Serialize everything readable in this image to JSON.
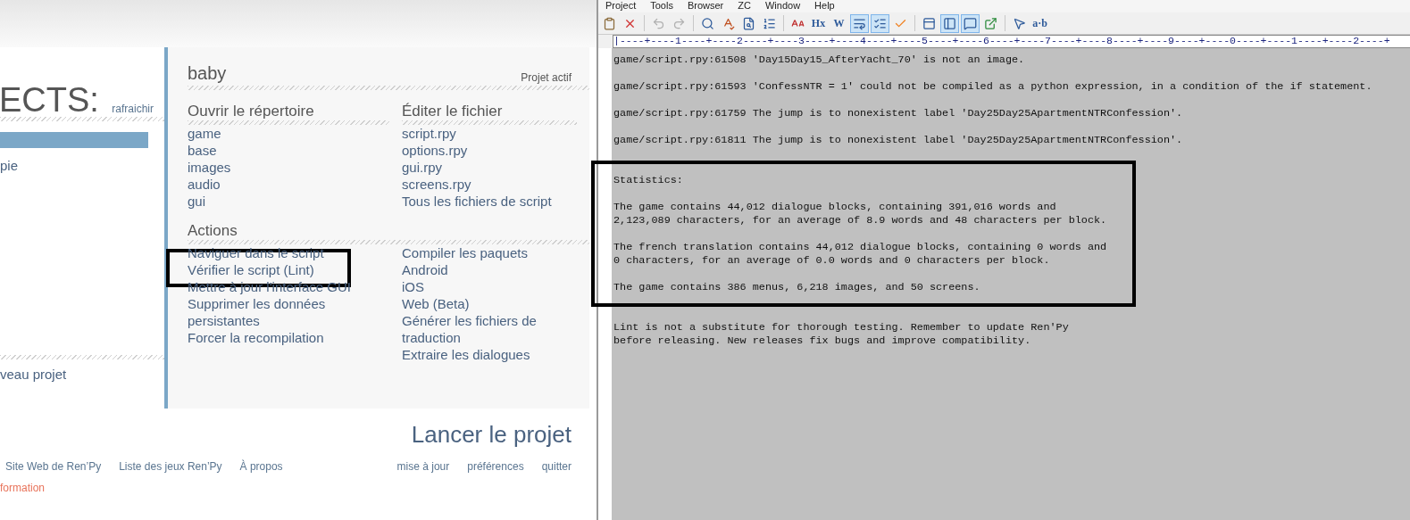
{
  "launcher": {
    "projects_heading": "ECTS:",
    "refresh_link": "rafraichir",
    "project_items": [
      {
        "selected": true
      },
      {
        "label": "pie",
        "selected": false
      }
    ],
    "new_project": "veau projet",
    "project": {
      "name": "baby",
      "badge": "Projet actif",
      "sections": [
        {
          "title": "Ouvrir le répertoire",
          "items": [
            "game",
            "base",
            "images",
            "audio",
            "gui"
          ]
        },
        {
          "title": "Éditer le fichier",
          "items": [
            "script.rpy",
            "options.rpy",
            "gui.rpy",
            "screens.rpy",
            "Tous les fichiers de script"
          ]
        }
      ],
      "actions_title": "Actions",
      "actions_left": [
        "Naviguer dans le script",
        "Vérifier le script (Lint)",
        "Mettre à jour l'interface GUI",
        "Supprimer les données persistantes",
        "Forcer la recompilation"
      ],
      "actions_right": [
        "Compiler les paquets",
        "Android",
        "iOS",
        "Web (Beta)",
        "Générer les fichiers de traduction",
        "Extraire les dialogues"
      ]
    },
    "launch_button": "Lancer le projet",
    "footer_left": [
      "Site Web de Ren’Py",
      "Liste des jeux Ren’Py",
      "À propos"
    ],
    "footer_right": [
      "mise à jour",
      "préférences",
      "quitter"
    ],
    "notice": "formation"
  },
  "editor": {
    "menu": [
      "Project",
      "Tools",
      "Browser",
      "ZC",
      "Window",
      "Help"
    ],
    "toolbar": [
      {
        "kind": "paste",
        "pressed": false,
        "disabled": false
      },
      {
        "kind": "delete",
        "pressed": false,
        "disabled": false
      },
      {
        "kind": "separator"
      },
      {
        "kind": "undo",
        "pressed": false,
        "disabled": true
      },
      {
        "kind": "redo",
        "pressed": false,
        "disabled": true
      },
      {
        "kind": "separator"
      },
      {
        "kind": "find",
        "pressed": false,
        "disabled": false
      },
      {
        "kind": "spell",
        "pressed": false,
        "disabled": false
      },
      {
        "kind": "replace",
        "pressed": false,
        "disabled": false
      },
      {
        "kind": "indent",
        "pressed": false,
        "disabled": false
      },
      {
        "kind": "separator"
      },
      {
        "kind": "font",
        "pressed": false,
        "disabled": false
      },
      {
        "kind": "text",
        "label": "Hx",
        "pressed": false,
        "disabled": false
      },
      {
        "kind": "text",
        "label": "W",
        "pressed": false,
        "disabled": false
      },
      {
        "kind": "wrap",
        "pressed": true,
        "disabled": false
      },
      {
        "kind": "numbers",
        "pressed": true,
        "disabled": false
      },
      {
        "kind": "check",
        "pressed": false,
        "disabled": false
      },
      {
        "kind": "separator"
      },
      {
        "kind": "panel",
        "pressed": false,
        "disabled": false
      },
      {
        "kind": "sidebar",
        "pressed": true,
        "disabled": false
      },
      {
        "kind": "output",
        "pressed": true,
        "disabled": false
      },
      {
        "kind": "popout",
        "pressed": false,
        "disabled": false
      },
      {
        "kind": "separator"
      },
      {
        "kind": "help",
        "pressed": false,
        "disabled": false
      },
      {
        "kind": "text",
        "label": "a·b",
        "pressed": false,
        "disabled": false
      }
    ],
    "ruler": "|----+----1----+----2----+----3----+----4----+----5----+----6----+----7----+----8----+----9----+----0----+----1----+----2----+",
    "blocks": [
      {
        "lines": [
          "game/script.rpy:61508 'Day15Day15_AfterYacht_70' is not an image."
        ]
      },
      {
        "lines": [
          "game/script.rpy:61593 'ConfessNTR = 1' could not be compiled as a python expression, in a condition of the if statement."
        ]
      },
      {
        "lines": [
          "game/script.rpy:61759 The jump is to nonexistent label 'Day25Day25ApartmentNTRConfession'."
        ]
      },
      {
        "lines": [
          "game/script.rpy:61811 The jump is to nonexistent label 'Day25Day25ApartmentNTRConfession'."
        ]
      }
    ],
    "statistics": [
      {
        "lines": [
          "Statistics:"
        ]
      },
      {
        "lines": [
          "The game contains 44,012 dialogue blocks, containing 391,016 words and",
          "2,123,089 characters, for an average of 8.9 words and 48 characters per block."
        ]
      },
      {
        "lines": [
          "The french translation contains 44,012 dialogue blocks, containing 0 words and",
          "0 characters, for an average of 0.0 words and 0 characters per block."
        ]
      },
      {
        "lines": [
          "The game contains 386 menus, 6,218 images, and 50 screens."
        ]
      }
    ],
    "closing": [
      {
        "lines": [
          "Lint is not a substitute for thorough testing. Remember to update Ren'Py",
          "before releasing. New releases fix bugs and improve compatibility."
        ]
      }
    ]
  }
}
